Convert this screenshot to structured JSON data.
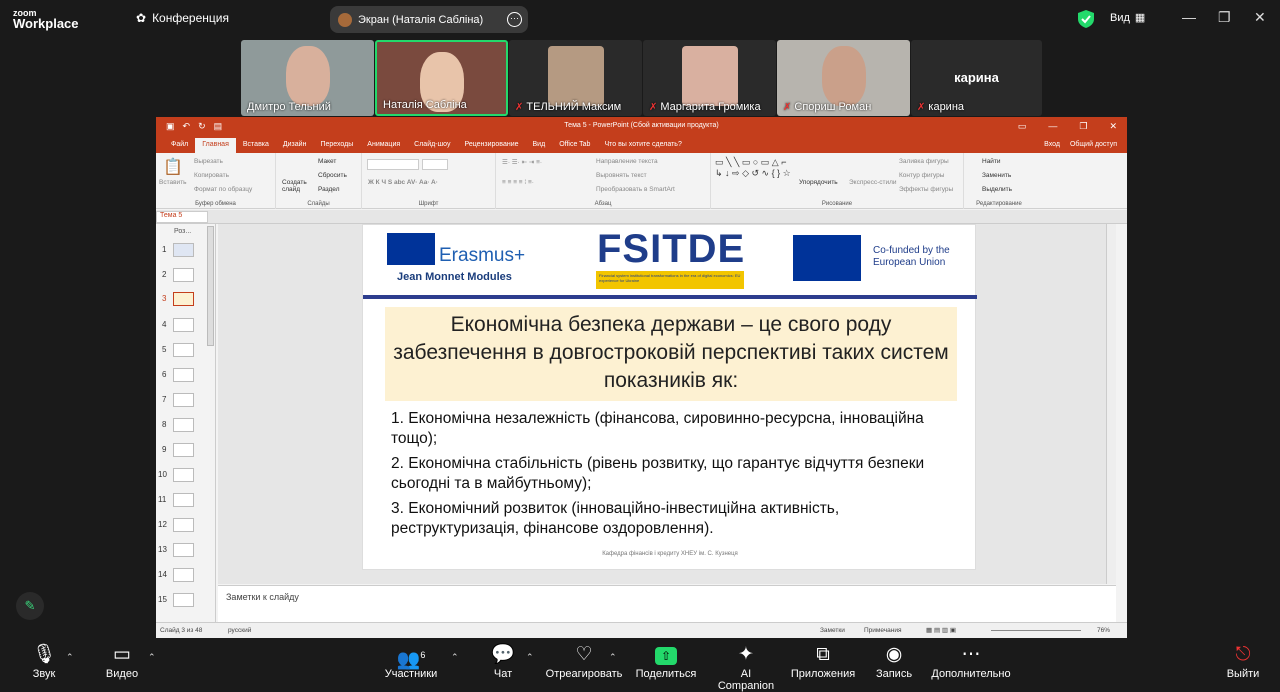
{
  "app": {
    "logo_top": "zoom",
    "logo_bottom": "Workplace",
    "conference_label": "Конференция",
    "share_pill": "Экран (Наталія Сабліна)",
    "view_label": "Вид"
  },
  "participants": [
    {
      "name": "Дмитро Тельний",
      "muted": false
    },
    {
      "name": "Наталія Сабліна",
      "muted": false
    },
    {
      "name": "ТЕЛЬНИЙ Максим",
      "muted": true
    },
    {
      "name": "Маргарита Громика",
      "muted": true
    },
    {
      "name": "Спориш Роман",
      "muted": true
    },
    {
      "name": "карина",
      "muted": true,
      "label": "карина"
    }
  ],
  "ppt": {
    "title": "Тема 5 - PowerPoint (Сбой активации продукта)",
    "tabs": [
      "Файл",
      "Главная",
      "Вставка",
      "Дизайн",
      "Переходы",
      "Анимация",
      "Слайд-шоу",
      "Рецензирование",
      "Вид",
      "Office Tab",
      "Что вы хотите сделать?"
    ],
    "right_tabs": [
      "Вход",
      "Общий доступ"
    ],
    "ribbon": {
      "paste": "Вставить",
      "cut": "Вырезать",
      "copy": "Копировать",
      "format": "Формат по образцу",
      "clipboard": "Буфер обмена",
      "create_slide": "Создать слайд",
      "layout": "Макет",
      "reset": "Сбросить",
      "section": "Раздел",
      "slides": "Слайды",
      "font": "Шрифт",
      "paragraph": "Абзац",
      "text_dir": "Направление текста",
      "align_text": "Выровнять текст",
      "smartart": "Преобразовать в SmartArt",
      "arrange": "Упорядочить",
      "quick_styles": "Экспресс-стили",
      "drawing": "Рисование",
      "fill": "Заливка фигуры",
      "outline": "Контур фигуры",
      "effects": "Эффекты фигуры",
      "find": "Найти",
      "replace": "Заменить",
      "select": "Выделить",
      "editing": "Редактирование"
    },
    "doc_tab": "Тема 5",
    "panel_label": "Роз...",
    "slide_numbers": [
      "1",
      "2",
      "3",
      "4",
      "5",
      "6",
      "7",
      "8",
      "9",
      "10",
      "11",
      "12",
      "13",
      "14",
      "15"
    ],
    "selected_slide": 3,
    "notes_placeholder": "Заметки к слайду",
    "status": {
      "slide": "Слайд 3 из 48",
      "lang": "русский",
      "notes": "Заметки",
      "comments": "Примечания",
      "zoom": "76%"
    }
  },
  "slide": {
    "erasmus": "Erasmus+",
    "jmm": "Jean Monnet Modules",
    "fsitde": "FSITDE",
    "fsitde_sub": "Financial system institutional transformations in the era of digital economics: EU experience for Ukraine",
    "cofund_1": "Co-funded by the",
    "cofund_2": "European Union",
    "title": "Економічна безпека держави – це свого роду забезпечення в довгостроковій перспективі таких систем показників як:",
    "items": [
      "1. Економічна незалежність (фінансова, сировинно-ресурсна, інноваційна тощо);",
      "2. Економічна стабільність (рівень розвитку, що гарантує відчуття безпеки сьогодні та в майбутньому);",
      "3. Економічний розвиток (інноваційно-інвестиційна активність, реструктуризація, фінансове оздоровлення)."
    ],
    "footer": "Кафедра фінансів і кредиту ХНЕУ ім. С. Кузнеця"
  },
  "toolbar": {
    "audio": "Звук",
    "video": "Видео",
    "participants": "Участники",
    "participants_count": "6",
    "chat": "Чат",
    "react": "Отреагировать",
    "share": "Поделиться",
    "ai": "AI Companion",
    "apps": "Приложения",
    "record": "Запись",
    "more": "Дополнительно",
    "leave": "Выйти"
  }
}
